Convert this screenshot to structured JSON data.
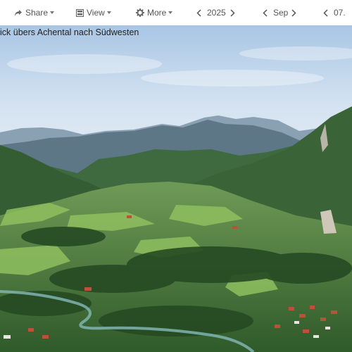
{
  "toolbar": {
    "share_label": "Share",
    "view_label": "View",
    "more_label": "More",
    "year": "2025",
    "month": "Sep",
    "day": "07.",
    "icons": [
      "share-icon",
      "view-icon",
      "gear-icon",
      "chevron-left-icon",
      "chevron-right-icon",
      "caret-down-icon"
    ]
  },
  "photo": {
    "caption": "ick übers Achental nach Südwesten"
  },
  "colors": {
    "toolbar_bg": "#ffffff",
    "toolbar_text": "#555555",
    "sky": "#c9dcef"
  }
}
